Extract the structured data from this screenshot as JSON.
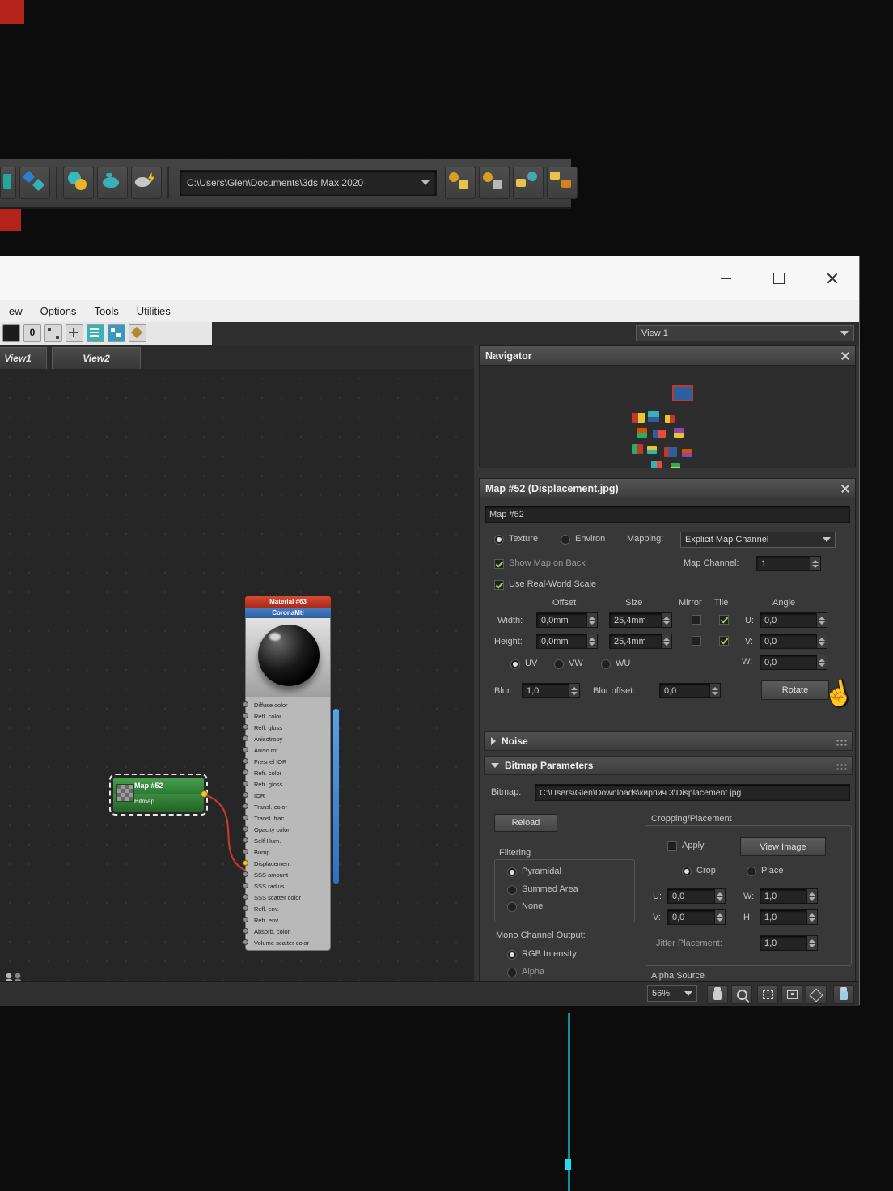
{
  "top_toolbar": {
    "path_value": "C:\\Users\\Glen\\Documents\\3ds Max 2020"
  },
  "window": {
    "menu_items": [
      "ew",
      "Options",
      "Tools",
      "Utilities"
    ],
    "view_dropdown": "View 1",
    "tabs": [
      "View1",
      "View2"
    ]
  },
  "navigator": {
    "title": "Navigator"
  },
  "material_node": {
    "title": "Material #63",
    "subtitle": "CoronaMtl",
    "slots": [
      "Diffuse color",
      "Refl. color",
      "Refl. gloss",
      "Anisotropy",
      "Aniso rot.",
      "Fresnel IOR",
      "Refr. color",
      "Refr. gloss",
      "IOR",
      "Transl. color",
      "Transl. frac",
      "Opacity color",
      "Self-Illum.",
      "Bump",
      "Displacement",
      "SSS amount",
      "SSS radius",
      "SSS scatter color",
      "Refl. env.",
      "Refr. env.",
      "Absorb. color",
      "Volume scatter color"
    ]
  },
  "map_node": {
    "title": "Map #52",
    "subtitle": "Bitmap"
  },
  "map_panel": {
    "title": "Map #52 (Displacement.jpg)",
    "name_field": "Map #52",
    "coordinates": {
      "texture_label": "Texture",
      "environ_label": "Environ",
      "mapping_label": "Mapping:",
      "mapping_value": "Explicit Map Channel",
      "show_map_on_back": "Show Map on Back",
      "map_channel_label": "Map Channel:",
      "map_channel_value": "1",
      "use_real_world_scale": "Use Real-World Scale",
      "col_offset": "Offset",
      "col_size": "Size",
      "col_mirror": "Mirror",
      "col_tile": "Tile",
      "col_angle": "Angle",
      "width_label": "Width:",
      "width_offset": "0,0mm",
      "width_size": "25,4mm",
      "height_label": "Height:",
      "height_offset": "0,0mm",
      "height_size": "25,4mm",
      "u_label": "U:",
      "u_value": "0,0",
      "v_label": "V:",
      "v_value": "0,0",
      "w_label": "W:",
      "w_value": "0,0",
      "uv_label": "UV",
      "vw_label": "VW",
      "wu_label": "WU",
      "blur_label": "Blur:",
      "blur_value": "1,0",
      "blur_offset_label": "Blur offset:",
      "blur_offset_value": "0,0",
      "rotate_button": "Rotate"
    },
    "noise_rollout": "Noise",
    "bitmap_rollout": "Bitmap Parameters",
    "bitmap_params": {
      "bitmap_label": "Bitmap:",
      "bitmap_path": "C:\\Users\\Glen\\Downloads\\кирпич 3\\Displacement.jpg",
      "reload_button": "Reload",
      "cropping_title": "Cropping/Placement",
      "apply_label": "Apply",
      "view_image_button": "View Image",
      "crop_label": "Crop",
      "place_label": "Place",
      "u_label": "U:",
      "u_value": "0,0",
      "v_label": "V:",
      "v_value": "0,0",
      "w_label": "W:",
      "w_value": "1,0",
      "h_label": "H:",
      "h_value": "1,0",
      "jitter_label": "Jitter Placement:",
      "jitter_value": "1,0",
      "filtering_title": "Filtering",
      "filter_options": [
        "Pyramidal",
        "Summed Area",
        "None"
      ],
      "mono_title": "Mono Channel Output:",
      "mono_options": [
        "RGB Intensity",
        "Alpha"
      ],
      "alpha_source_title": "Alpha Source"
    }
  },
  "status_bar": {
    "zoom": "56%"
  },
  "icons": {
    "hand_cursor_glyph": "☝"
  },
  "colors": {
    "accent_blue": "#2f6fc0",
    "node_green": "#2e7a34",
    "node_red": "#a82a18",
    "wire_red": "#c23b2e",
    "check_green": "#a5d24a"
  }
}
